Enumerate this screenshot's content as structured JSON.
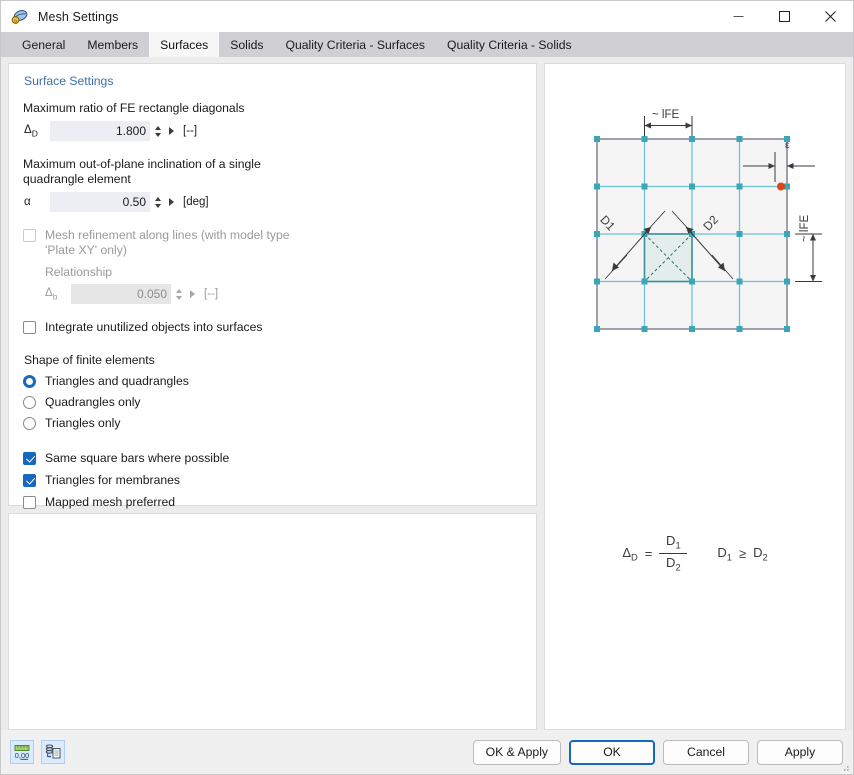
{
  "window": {
    "title": "Mesh Settings",
    "icon": "mesh-settings-icon",
    "minimize": "—",
    "maximize": "□",
    "close": "✕"
  },
  "tabs": [
    {
      "label": "General",
      "active": false
    },
    {
      "label": "Members",
      "active": false
    },
    {
      "label": "Surfaces",
      "active": true
    },
    {
      "label": "Solids",
      "active": false
    },
    {
      "label": "Quality Criteria - Surfaces",
      "active": false
    },
    {
      "label": "Quality Criteria - Solids",
      "active": false
    }
  ],
  "surface_settings": {
    "group_title": "Surface Settings",
    "ratio": {
      "label": "Maximum ratio of FE rectangle diagonals",
      "symbol": "Δ",
      "symbol_sub": "D",
      "value": "1.800",
      "unit": "[--]"
    },
    "inclination": {
      "label": "Maximum out-of-plane inclination of a single quadrangle element",
      "symbol": "α",
      "symbol_sub": "",
      "value": "0.50",
      "unit": "[deg]"
    },
    "refinement": {
      "checkbox_label": "Mesh refinement along lines (with model type 'Plate XY' only)",
      "checked": false,
      "enabled": false,
      "relationship_label": "Relationship",
      "symbol": "Δ",
      "symbol_sub": "b",
      "value": "0.050",
      "unit": "[--]"
    },
    "integrate": {
      "label": "Integrate unutilized objects into surfaces",
      "checked": false
    },
    "shape": {
      "header": "Shape of finite elements",
      "options": [
        {
          "label": "Triangles and quadrangles",
          "selected": true
        },
        {
          "label": "Quadrangles only",
          "selected": false
        },
        {
          "label": "Triangles only",
          "selected": false
        }
      ]
    },
    "extra_checks": [
      {
        "label": "Same square bars where possible",
        "checked": true
      },
      {
        "label": "Triangles for membranes",
        "checked": true
      },
      {
        "label": "Mapped mesh preferred",
        "checked": false
      }
    ]
  },
  "diagram": {
    "top_dim_label": "~ lFE",
    "right_dim_label": "~ lFE",
    "epsilon_label": "ε",
    "diagonal_1": "D1",
    "diagonal_2": "D2",
    "formula": {
      "lhs_symbol": "Δ",
      "lhs_sub": "D",
      "equals": "=",
      "numerator": "D",
      "numerator_sub": "1",
      "denominator": "D",
      "denominator_sub": "2",
      "condition_left": "D",
      "condition_left_sub": "1",
      "condition_op": "≥",
      "condition_right": "D",
      "condition_right_sub": "2"
    },
    "colors": {
      "grid": "#4fb6c6",
      "border": "#8a8a9a",
      "node": "#3aa6b9",
      "highlight_fill": "#e3eeec",
      "marker": "#e0431a"
    }
  },
  "footer": {
    "tool_icons": [
      {
        "name": "units-icon",
        "label": "0,00"
      },
      {
        "name": "configuration-manager-icon",
        "label": ""
      }
    ],
    "buttons": [
      {
        "label": "OK & Apply",
        "primary": false
      },
      {
        "label": "OK",
        "primary": true
      },
      {
        "label": "Cancel",
        "primary": false
      },
      {
        "label": "Apply",
        "primary": false
      }
    ]
  }
}
